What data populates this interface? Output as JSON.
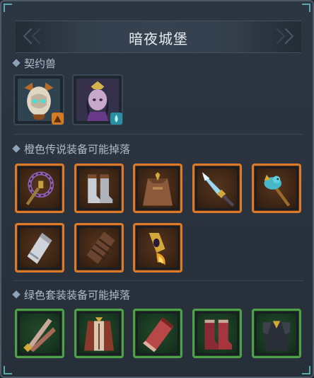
{
  "window": {
    "title": "暗夜城堡"
  },
  "sections": {
    "pets": {
      "label": "契约兽"
    },
    "orange": {
      "label": "橙色传说装备可能掉落"
    },
    "green": {
      "label": "绿色套装装备可能掉落"
    }
  },
  "pets": [
    {
      "icon": "armored-beast-pet",
      "badge_icon": "earth-element-icon",
      "badge_color": "#d27a24"
    },
    {
      "icon": "horned-sorceress-pet",
      "badge_icon": "water-drop-icon",
      "badge_color": "#2a8fa0"
    }
  ],
  "orange_items": [
    {
      "icon": "ornate-staff-icon"
    },
    {
      "icon": "silver-boots-icon"
    },
    {
      "icon": "leather-robe-icon"
    },
    {
      "icon": "ice-blade-icon"
    },
    {
      "icon": "bird-scepter-icon"
    },
    {
      "icon": "silver-bracer-icon"
    },
    {
      "icon": "leather-bracer-icon"
    },
    {
      "icon": "flame-amulet-icon"
    }
  ],
  "green_items": [
    {
      "icon": "twin-feather-dagger-icon"
    },
    {
      "icon": "crimson-coat-icon"
    },
    {
      "icon": "crimson-bracer-icon"
    },
    {
      "icon": "crimson-boots-icon"
    },
    {
      "icon": "dark-chestplate-icon"
    }
  ],
  "colors": {
    "legendary_border": "#dc7a2c",
    "set_border": "#4fa04a"
  }
}
